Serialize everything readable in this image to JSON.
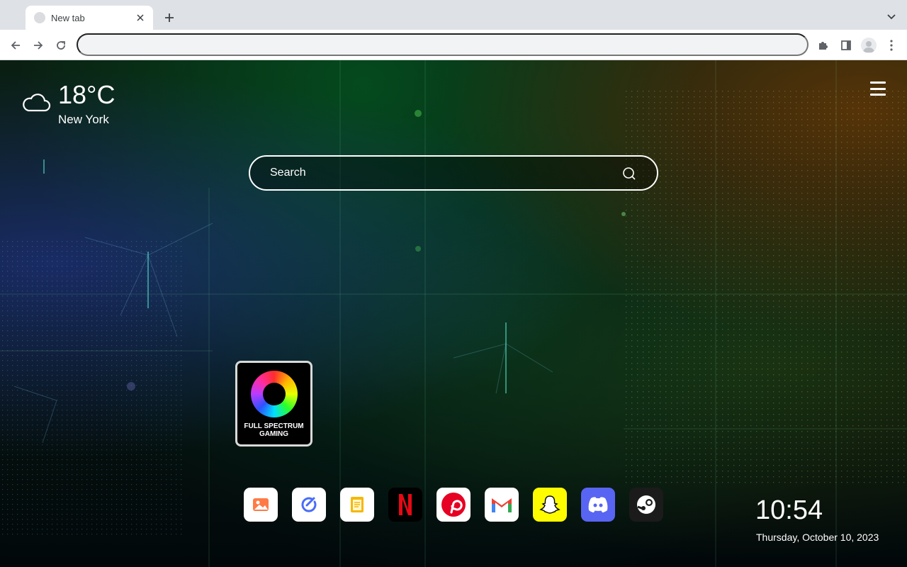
{
  "browser": {
    "tab_title": "New tab",
    "address_value": "",
    "icons": [
      "tab-favicon",
      "close-icon",
      "plus-icon",
      "chevron-down-icon",
      "back-arrow-icon",
      "forward-arrow-icon",
      "reload-icon",
      "extensions-puzzle-icon",
      "side-panel-icon",
      "profile-avatar-icon",
      "kebab-menu-icon"
    ]
  },
  "weather": {
    "temperature": "18°C",
    "city": "New York",
    "icon": "cloud-icon"
  },
  "search": {
    "placeholder": "Search",
    "icon": "search-icon"
  },
  "featured_tile": {
    "label": "FULL SPECTRUM GAMING"
  },
  "dock": {
    "apps": [
      {
        "name": "photos",
        "icon": "image-icon",
        "color": "#ff7a45"
      },
      {
        "name": "tasks",
        "icon": "check-circle-icon",
        "color": "#4a6cf7"
      },
      {
        "name": "notes",
        "icon": "note-icon",
        "color": "#f5b800"
      },
      {
        "name": "netflix",
        "icon": "netflix-icon",
        "color": "#e50914"
      },
      {
        "name": "pinterest",
        "icon": "pinterest-icon",
        "color": "#e60023"
      },
      {
        "name": "gmail",
        "icon": "gmail-icon",
        "color": "#ea4335"
      },
      {
        "name": "snapchat",
        "icon": "snapchat-icon",
        "color": "#fffc00"
      },
      {
        "name": "discord",
        "icon": "discord-icon",
        "color": "#5865f2"
      },
      {
        "name": "steam",
        "icon": "steam-icon",
        "color": "#1b1b1b"
      }
    ]
  },
  "clock": {
    "time": "10:54",
    "date": "Thursday, October 10, 2023"
  }
}
